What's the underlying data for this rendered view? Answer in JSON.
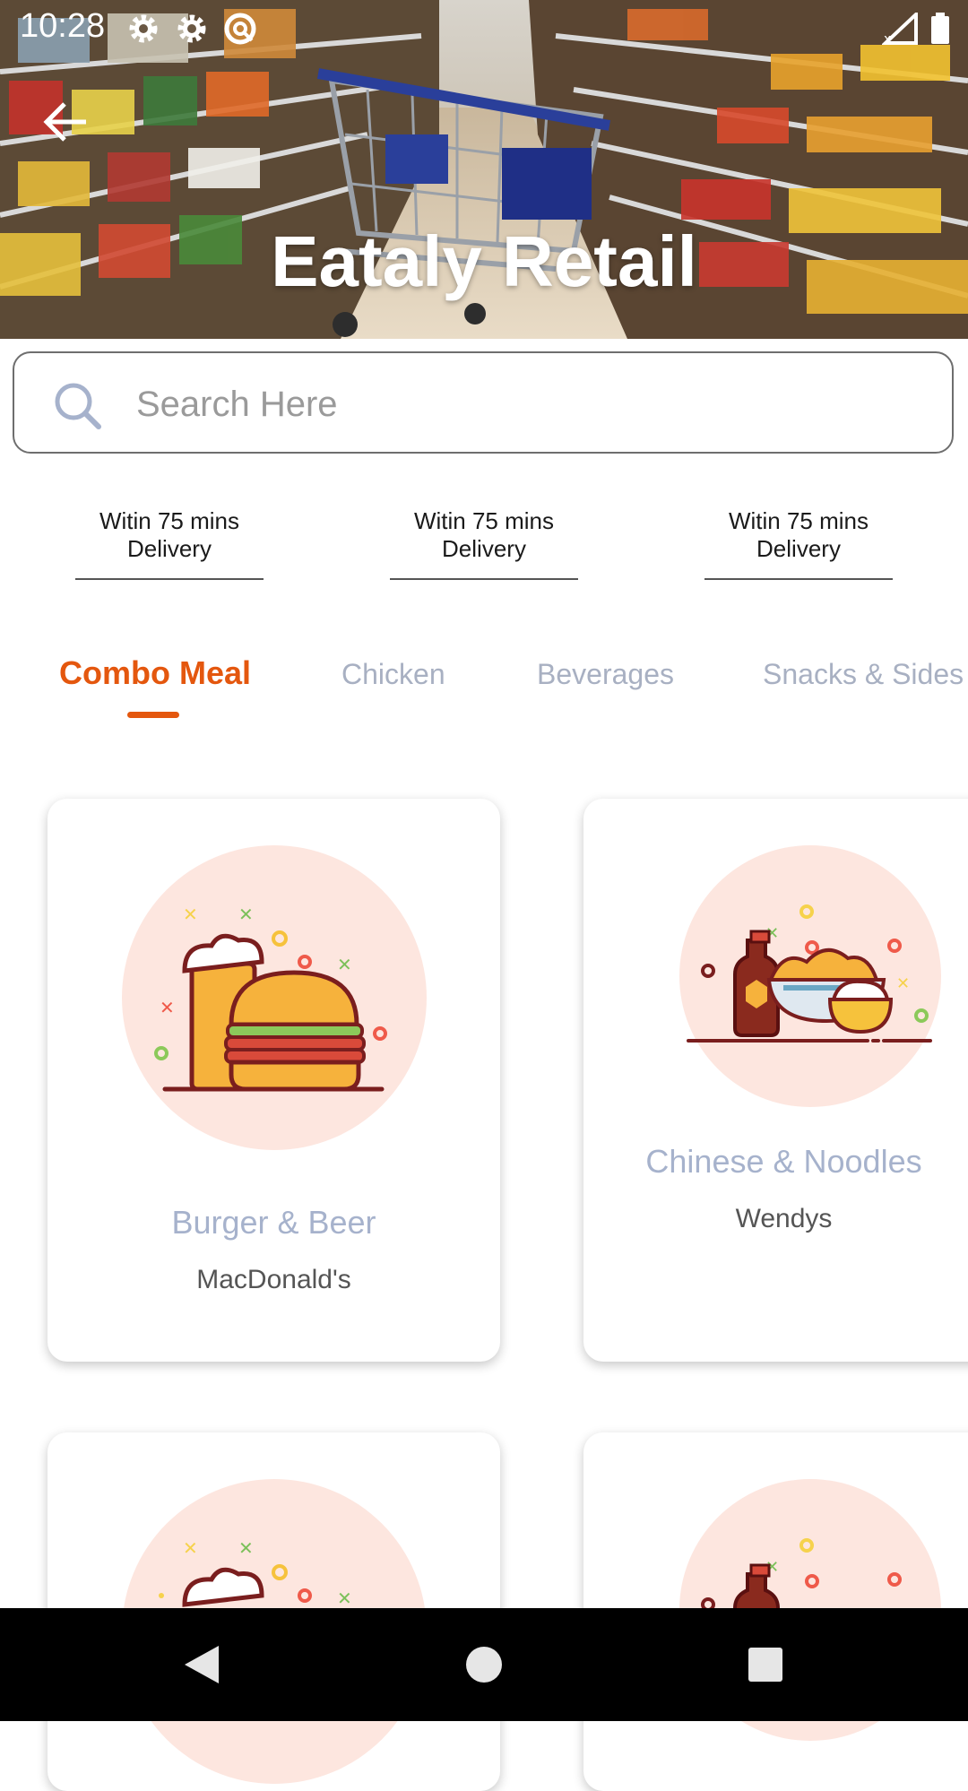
{
  "status_bar": {
    "time": "10:28",
    "left_icons": [
      "settings-icon",
      "settings-icon",
      "sync-icon"
    ],
    "right_icons": [
      "signal-icon",
      "battery-icon"
    ]
  },
  "header": {
    "title": "Eataly Retail",
    "back_icon": "arrow-left-icon"
  },
  "search": {
    "placeholder": "Search Here",
    "value": "",
    "icon": "search-icon"
  },
  "delivery_options": [
    {
      "line1": "Witin 75 mins",
      "line2": "Delivery"
    },
    {
      "line1": "Witin 75 mins",
      "line2": "Delivery"
    },
    {
      "line1": "Witin 75 mins",
      "line2": "Delivery"
    }
  ],
  "tabs": [
    {
      "label": "Combo Meal",
      "active": true
    },
    {
      "label": "Chicken",
      "active": false
    },
    {
      "label": "Beverages",
      "active": false
    },
    {
      "label": "Snacks & Sides",
      "active": false
    }
  ],
  "cards": [
    {
      "title": "Burger & Beer",
      "subtitle": "MacDonald's",
      "icon": "burger-beer-icon"
    },
    {
      "title": "Chinese & Noodles",
      "subtitle": "Wendys",
      "icon": "noodles-icon"
    },
    {
      "title": "",
      "subtitle": "",
      "icon": "burger-beer-icon"
    },
    {
      "title": "",
      "subtitle": "",
      "icon": "noodles-icon"
    }
  ],
  "colors": {
    "accent": "#e4570e",
    "tab_inactive": "#a8b0c2",
    "card_title": "#a6b2cc",
    "illustration_bg": "#fde6df"
  },
  "nav_bar": {
    "buttons": [
      "back-triangle-icon",
      "home-circle-icon",
      "recents-square-icon"
    ]
  }
}
